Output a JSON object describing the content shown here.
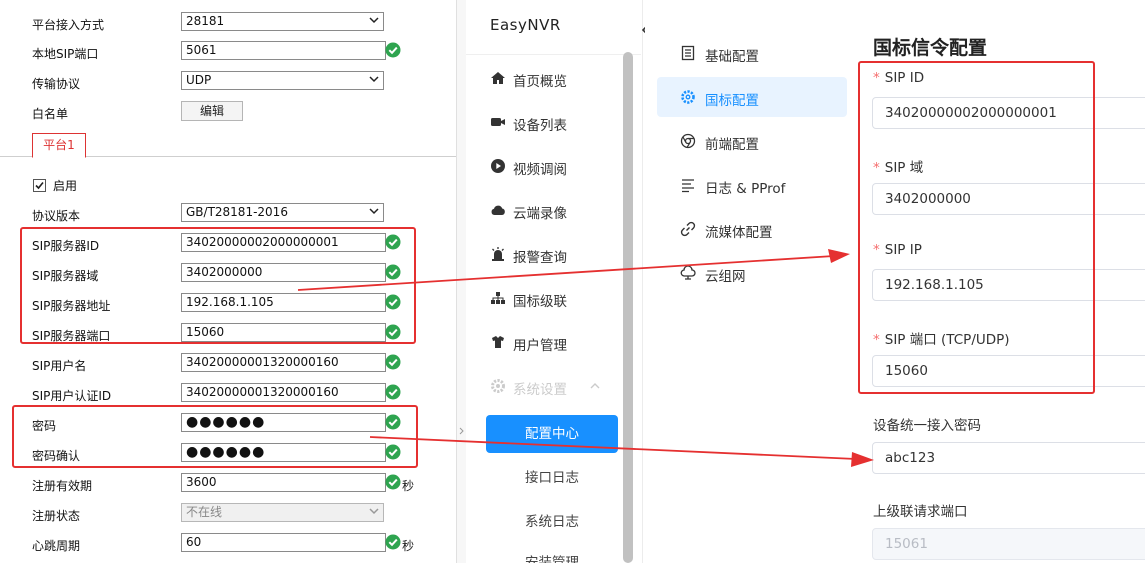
{
  "device_config": {
    "rows_top": [
      {
        "label": "平台接入方式",
        "value": "28181",
        "kind": "select"
      },
      {
        "label": "本地SIP端口",
        "value": "5061",
        "kind": "input",
        "ok": true
      },
      {
        "label": "传输协议",
        "value": "UDP",
        "kind": "select"
      }
    ],
    "whitelist_label": "白名单",
    "whitelist_button": "编辑",
    "platform_tab": "平台1",
    "enable_label": "启用",
    "enable_checked": true,
    "rows_bottom": [
      {
        "label": "协议版本",
        "value": "GB/T28181-2016",
        "kind": "select"
      },
      {
        "label": "SIP服务器ID",
        "value": "34020000002000000001",
        "kind": "input",
        "ok": true
      },
      {
        "label": "SIP服务器域",
        "value": "3402000000",
        "kind": "input",
        "ok": true
      },
      {
        "label": "SIP服务器地址",
        "value": "192.168.1.105",
        "kind": "input",
        "ok": true
      },
      {
        "label": "SIP服务器端口",
        "value": "15060",
        "kind": "input",
        "ok": true
      },
      {
        "label": "SIP用户名",
        "value": "34020000001320000160",
        "kind": "input",
        "ok": true
      },
      {
        "label": "SIP用户认证ID",
        "value": "34020000001320000160",
        "kind": "input",
        "ok": true
      },
      {
        "label": "密码",
        "value": "●●●●●●",
        "kind": "password",
        "ok": true
      },
      {
        "label": "密码确认",
        "value": "●●●●●●",
        "kind": "password",
        "ok": true
      },
      {
        "label": "注册有效期",
        "value": "3600",
        "kind": "input",
        "ok": true,
        "unit": "秒"
      },
      {
        "label": "注册状态",
        "value": "不在线",
        "kind": "select-disabled"
      },
      {
        "label": "心跳周期",
        "value": "60",
        "kind": "input",
        "ok": true,
        "unit": "秒"
      }
    ]
  },
  "sidebar": {
    "brand": "EasyNVR",
    "items": [
      {
        "label": "首页概览",
        "icon": "home-icon"
      },
      {
        "label": "设备列表",
        "icon": "camera-icon"
      },
      {
        "label": "视频调阅",
        "icon": "play-icon"
      },
      {
        "label": "云端录像",
        "icon": "cloud-icon"
      },
      {
        "label": "报警查询",
        "icon": "alarm-icon"
      },
      {
        "label": "国标级联",
        "icon": "cascade-icon"
      },
      {
        "label": "用户管理",
        "icon": "user-icon"
      },
      {
        "label": "系统设置",
        "icon": "gear-icon"
      }
    ],
    "sub_items": [
      {
        "label": "配置中心",
        "active": true
      },
      {
        "label": "接口日志",
        "active": false
      },
      {
        "label": "系统日志",
        "active": false
      },
      {
        "label": "安装管理",
        "active": false
      }
    ]
  },
  "settings_menu": [
    {
      "label": "基础配置",
      "icon": "document-icon",
      "active": false
    },
    {
      "label": "国标配置",
      "icon": "gear-icon",
      "active": true
    },
    {
      "label": "前端配置",
      "icon": "chrome-icon",
      "active": false
    },
    {
      "label": "日志 & PProf",
      "icon": "list-icon",
      "active": false
    },
    {
      "label": "流媒体配置",
      "icon": "link-icon",
      "active": false
    },
    {
      "label": "云组网",
      "icon": "cloud-network-icon",
      "active": false
    }
  ],
  "gb_form": {
    "title": "国标信令配置",
    "fields": [
      {
        "label": "SIP ID",
        "required": true,
        "value": "34020000002000000001",
        "disabled": false
      },
      {
        "label": "SIP 域",
        "required": true,
        "value": "3402000000",
        "disabled": false
      },
      {
        "label": "SIP IP",
        "required": true,
        "value": "192.168.1.105",
        "disabled": false
      },
      {
        "label": "SIP 端口 (TCP/UDP)",
        "required": true,
        "value": "15060",
        "disabled": false
      },
      {
        "label": "设备统一接入密码",
        "required": false,
        "value": "abc123",
        "disabled": false
      },
      {
        "label": "上级联请求端口",
        "required": false,
        "value": "15061",
        "disabled": true
      }
    ]
  },
  "colors": {
    "accent": "#1890ff",
    "annotation_red": "#e53030",
    "ok_green": "#2ea44f",
    "required_star": "#f56c6c"
  }
}
